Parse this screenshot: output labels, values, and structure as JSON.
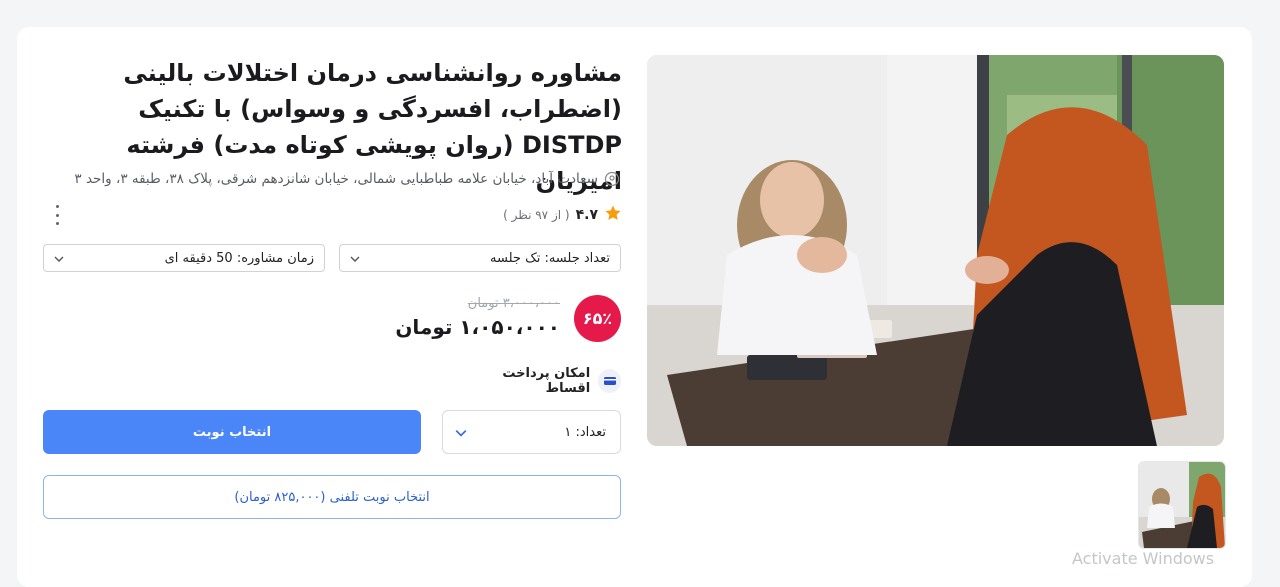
{
  "product": {
    "title": "مشاوره روانشناسی درمان اختلالات بالینی (اضطراب، افسردگی و وسواس) با تکنیک DISTDP (روان پویشی کوتاه مدت) فرشته امیریان",
    "address": "سعادت آباد، خیابان علامه طباطبایی شمالی، خیابان شانزدهم شرقی، پلاک ۳۸، طبقه ۳، واحد ۳",
    "rating": "۴.۷",
    "rating_count": "( از ۹۷ نظر )",
    "rating_value": 4.7,
    "review_count": 97
  },
  "options": {
    "session_count": "تعداد جلسه: تک جلسه",
    "duration": "زمان مشاوره: 50 دقیقه ای"
  },
  "pricing": {
    "discount": "۶۵٪",
    "old_price": "۳،۰۰۰،۰۰۰ تومان",
    "new_price": "۱،۰۵۰،۰۰۰ تومان"
  },
  "installment": {
    "label": "امکان پرداخت اقساط"
  },
  "quantity": {
    "label": "تعداد:",
    "value": "۱"
  },
  "buttons": {
    "select_slot": "انتخاب نوبت",
    "phone_slot": "انتخاب نوبت تلفنی (۸۲۵,۰۰۰ تومان)"
  },
  "system": {
    "watermark": "Activate Windows"
  },
  "colors": {
    "primary": "#4a86f7",
    "discount": "#e5194a",
    "star": "#f59e0b"
  }
}
